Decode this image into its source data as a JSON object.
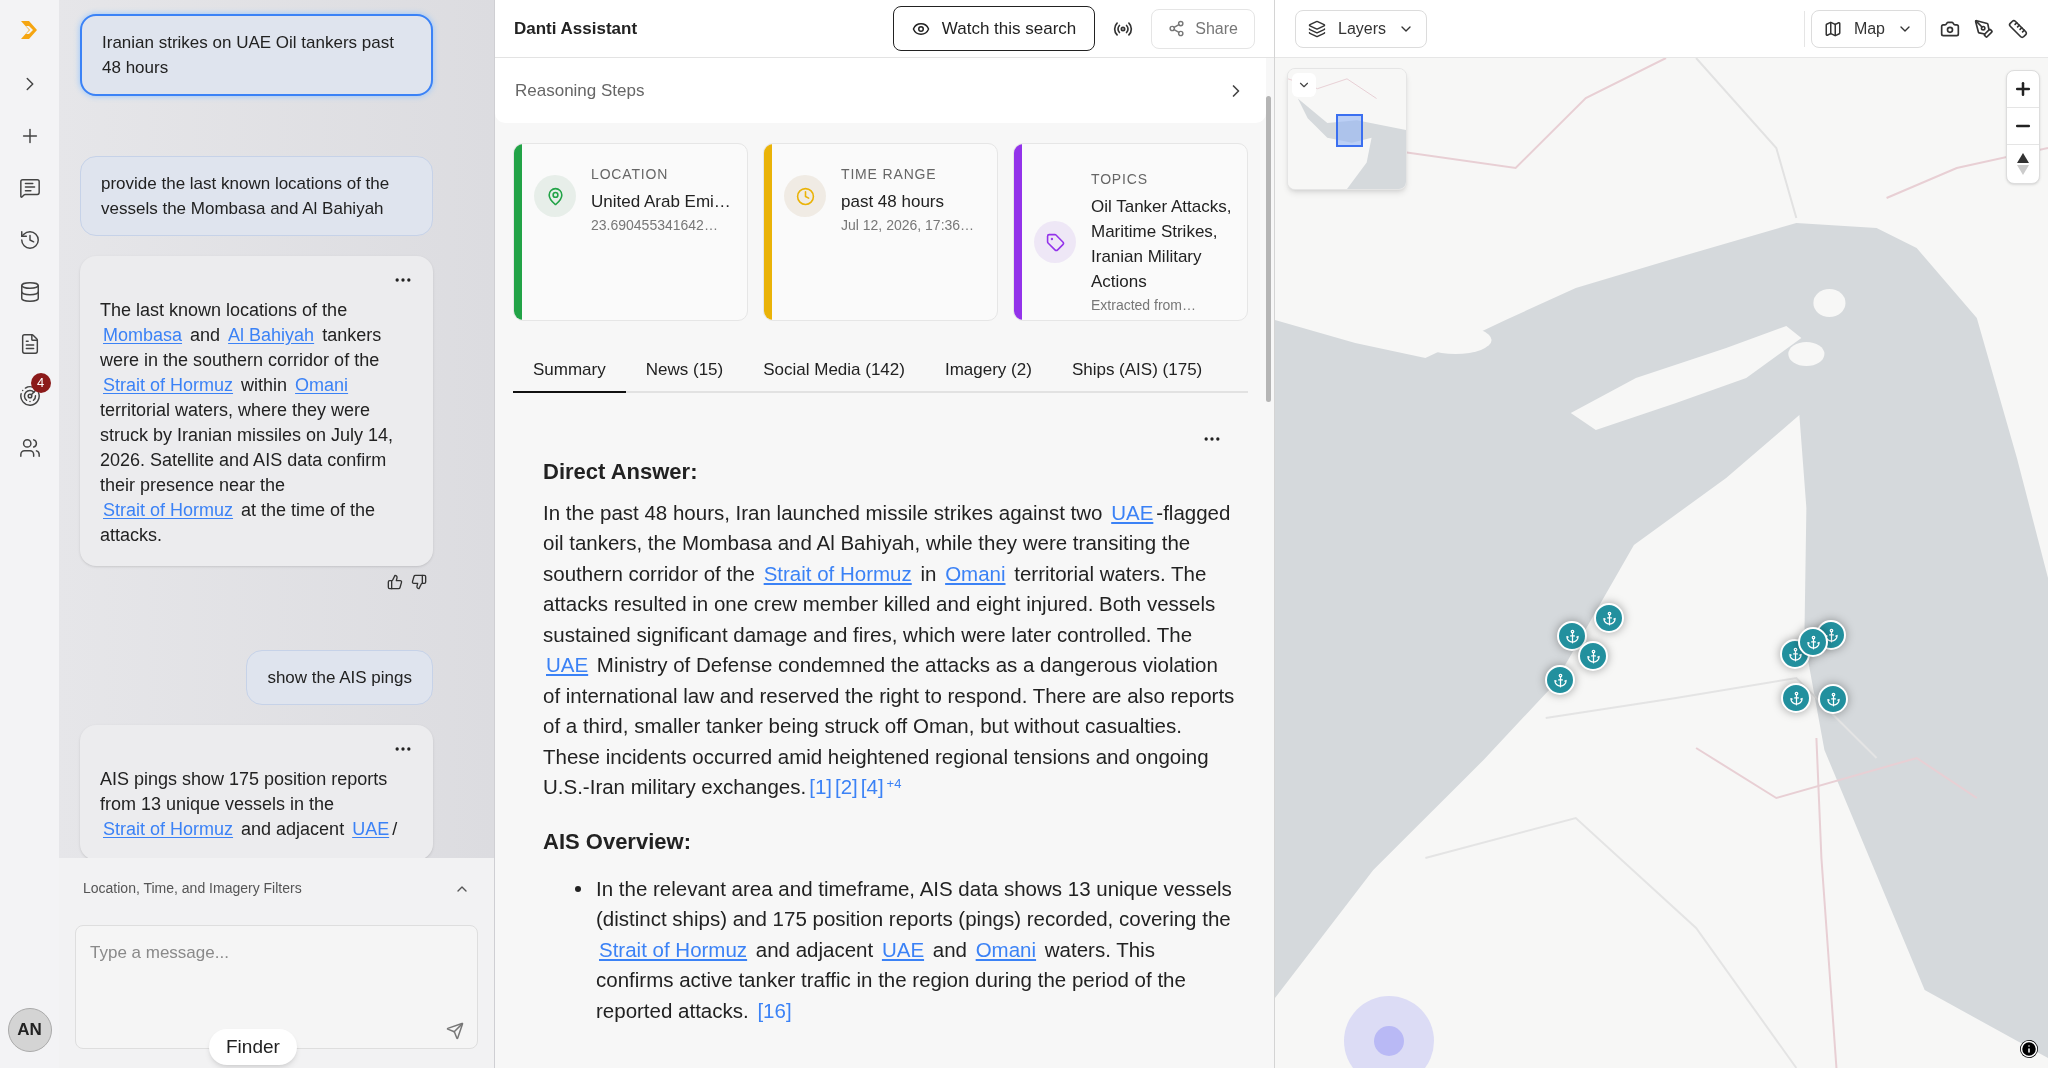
{
  "rail": {
    "badge": "4",
    "avatar": "AN"
  },
  "chat": {
    "messages": [
      {
        "kind": "user",
        "selected": true,
        "text": "Iranian strikes on UAE Oil tankers past 48 hours"
      },
      {
        "kind": "user",
        "selected": false,
        "text": "provide the last known locations of the vessels the Mombasa and Al Bahiyah"
      },
      {
        "kind": "answer",
        "feedback": true,
        "parts": [
          {
            "kind": "text",
            "text": "The last known locations of the "
          },
          {
            "kind": "link",
            "text": "Mombasa"
          },
          {
            "kind": "text",
            "text": " and "
          },
          {
            "kind": "link",
            "text": "Al Bahiyah"
          },
          {
            "kind": "text",
            "text": " tankers were in the southern corridor of the "
          },
          {
            "kind": "link",
            "text": "Strait of Hormuz"
          },
          {
            "kind": "text",
            "text": " within "
          },
          {
            "kind": "link",
            "text": "Omani"
          },
          {
            "kind": "text",
            "text": " territorial waters, where they were struck by Iranian missiles on July 14, 2026. Satellite and AIS data confirm their presence near the "
          },
          {
            "kind": "link",
            "text": "Strait of Hormuz"
          },
          {
            "kind": "text",
            "text": " at the time of the attacks."
          }
        ]
      },
      {
        "kind": "user",
        "selected": false,
        "text": "show the AIS pings"
      },
      {
        "kind": "answer",
        "feedback": false,
        "parts": [
          {
            "kind": "text",
            "text": "AIS pings show 175 position reports from 13 unique vessels in the "
          },
          {
            "kind": "link",
            "text": "Strait of Hormuz"
          },
          {
            "kind": "text",
            "text": " and adjacent "
          },
          {
            "kind": "link",
            "text": "UAE"
          },
          {
            "kind": "text",
            "text": "/"
          }
        ]
      }
    ]
  },
  "filters": {
    "label": "Location, Time, and Imagery Filters",
    "expanded": true
  },
  "composer": {
    "placeholder": "Type a message..."
  },
  "tooltip": "Finder",
  "assistant": {
    "title": "Danti Assistant",
    "watch_button": "Watch this search",
    "share_button": "Share",
    "reasoning": "Reasoning Steps",
    "cards": [
      {
        "kind": "location",
        "label": "LOCATION",
        "value": "United Arab Emi…",
        "detail": "23.690455341642…"
      },
      {
        "kind": "time",
        "label": "TIME RANGE",
        "value": "past 48 hours",
        "detail": "Jul 12, 2026, 17:36…"
      },
      {
        "kind": "topics",
        "label": "TOPICS",
        "value": "Oil Tanker Attacks, Maritime Strikes, Iranian Military Actions",
        "detail": "Extracted from…"
      }
    ],
    "tabs": [
      {
        "label": "Summary",
        "selected": true
      },
      {
        "label": "News (15)",
        "selected": false
      },
      {
        "label": "Social Media (142)",
        "selected": false
      },
      {
        "label": "Imagery (2)",
        "selected": false
      },
      {
        "label": "Ships (AIS) (175)",
        "selected": false
      }
    ],
    "sections": [
      {
        "kind": "paragraph",
        "heading": "Direct Answer:",
        "blocks": [
          [
            {
              "kind": "text",
              "text": "In the past 48 hours, Iran launched missile strikes against two "
            },
            {
              "kind": "link",
              "text": "UAE"
            },
            {
              "kind": "text",
              "text": "-flagged oil tankers, the Mombasa and Al Bahiyah, while they were transiting the southern corridor of the "
            },
            {
              "kind": "link",
              "text": "Strait of Hormuz"
            },
            {
              "kind": "text",
              "text": " in "
            },
            {
              "kind": "link",
              "text": "Omani"
            },
            {
              "kind": "text",
              "text": " territorial waters. The attacks resulted in one crew member killed and eight injured. Both vessels sustained significant damage and fires, which were later controlled. The "
            },
            {
              "kind": "link",
              "text": "UAE"
            },
            {
              "kind": "text",
              "text": " Ministry of Defense condemned the attacks as a dangerous violation of international law and reserved the right to respond. There are also reports of a third, smaller tanker being struck off Oman, but without casualties. These incidents occurred amid heightened regional tensions and ongoing U.S.-Iran military exchanges."
            },
            {
              "kind": "citation",
              "text": "[1]"
            },
            {
              "kind": "citation",
              "text": "[2]"
            },
            {
              "kind": "citation",
              "text": "[4]"
            },
            {
              "kind": "sup",
              "text": "+4"
            }
          ]
        ]
      },
      {
        "kind": "bullets",
        "heading": "AIS Overview:",
        "blocks": [
          [
            {
              "kind": "text",
              "text": "In the relevant area and timeframe, AIS data shows 13 unique vessels (distinct ships) and 175 position reports (pings) recorded, covering the "
            },
            {
              "kind": "link",
              "text": "Strait of Hormuz"
            },
            {
              "kind": "text",
              "text": " and adjacent "
            },
            {
              "kind": "link",
              "text": "UAE"
            },
            {
              "kind": "text",
              "text": " and "
            },
            {
              "kind": "link",
              "text": "Omani"
            },
            {
              "kind": "text",
              "text": " waters. This confirms active tanker traffic in the region during the period of the reported attacks. "
            },
            {
              "kind": "citation",
              "text": "[16]"
            }
          ]
        ]
      }
    ]
  },
  "map": {
    "layers_button": "Layers",
    "basemap_button": "Map"
  }
}
